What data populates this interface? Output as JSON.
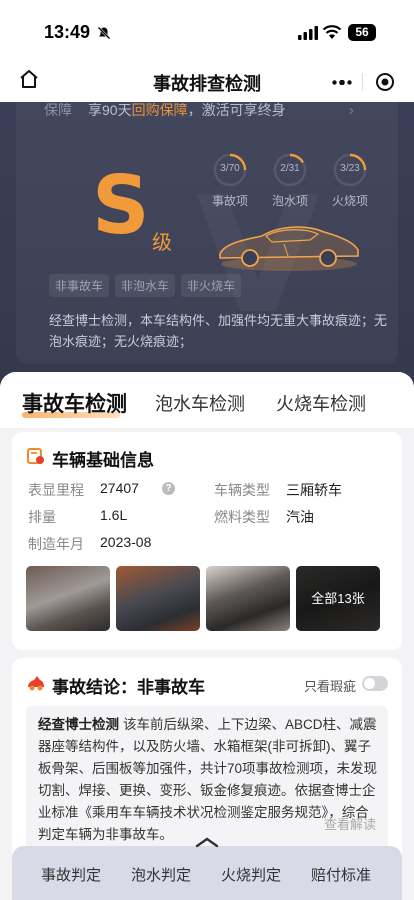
{
  "status_bar": {
    "time": "13:49",
    "battery": "56"
  },
  "nav": {
    "title": "事故排查检测"
  },
  "hero": {
    "guarantee_label": "保障",
    "guarantee_text_pre": "享90天",
    "guarantee_highlight": "回购保障",
    "guarantee_text_post": "，激活可享终身",
    "grade_letter": "S",
    "grade_suffix": "级",
    "gauges": [
      {
        "value": "3/70",
        "label": "事故项"
      },
      {
        "value": "2/31",
        "label": "泡水项"
      },
      {
        "value": "3/23",
        "label": "火烧项"
      }
    ],
    "tags": [
      "非事故车",
      "非泡水车",
      "非火烧车"
    ],
    "description": "经查博士检测，本车结构件、加强件均无重大事故痕迹；无泡水痕迹；无火烧痕迹；"
  },
  "tabs": [
    "事故车检测",
    "泡水车检测",
    "火烧车检测"
  ],
  "basic_info": {
    "title": "车辆基础信息",
    "fields": [
      {
        "label": "表显里程",
        "value": "27407"
      },
      {
        "label": "车辆类型",
        "value": "三厢轿车"
      },
      {
        "label": "排量",
        "value": "1.6L"
      },
      {
        "label": "燃料类型",
        "value": "汽油"
      },
      {
        "label": "制造年月",
        "value": "2023-08"
      }
    ],
    "help_icon": "?",
    "photos_more": "全部13张"
  },
  "conclusion": {
    "title": "事故结论：非事故车",
    "toggle_label": "只看瑕疵",
    "expert_badge": "经查博士检测",
    "text": "该车前后纵梁、上下边梁、ABCD柱、减震器座等结构件，以及防火墙、水箱框架(非可拆卸)、翼子板骨架、后围板等加强件，共计70项事故检测项，未发现切割、焊接、更换、变形、钣金修复痕迹。依据查博士企业标准《乘用车车辆技术状况检测鉴定服务规范》，综合判定车辆为非事故车。",
    "read_more": "查看解读"
  },
  "bottom_nav": [
    "事故判定",
    "泡水判定",
    "火烧判定",
    "赔付标准"
  ],
  "colors": {
    "accent": "#f09a3a",
    "hero_bg": "#3b3f56"
  }
}
